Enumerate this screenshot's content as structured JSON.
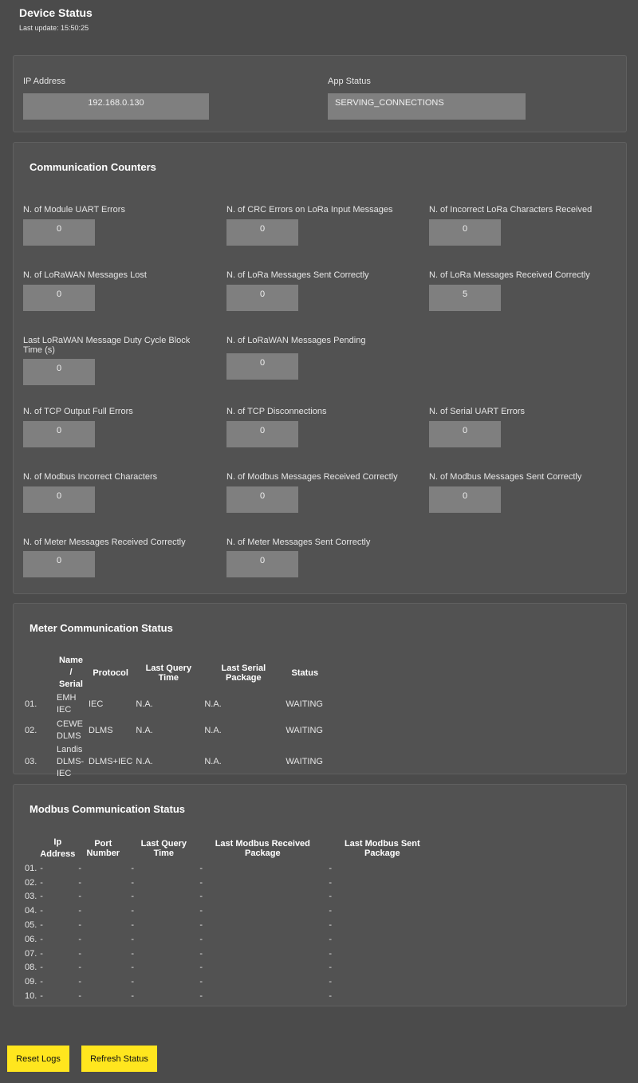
{
  "header": {
    "title": "Device Status",
    "last_update": "Last update: 15:50:25"
  },
  "network": {
    "ip_label": "IP Address",
    "ip_value": "192.168.0.130",
    "app_label": "App Status",
    "app_value": "SERVING_CONNECTIONS"
  },
  "counters": {
    "title": "Communication Counters",
    "items": [
      {
        "label": "N. of Module UART Errors",
        "value": "0"
      },
      {
        "label": "N. of CRC Errors on LoRa Input Messages",
        "value": "0"
      },
      {
        "label": "N. of Incorrect LoRa Characters Received",
        "value": "0"
      },
      {
        "label": "N. of LoRaWAN Messages Lost",
        "value": "0"
      },
      {
        "label": "N. of LoRa Messages Sent Correctly",
        "value": "0"
      },
      {
        "label": "N. of LoRa Messages Received Correctly",
        "value": "5"
      },
      {
        "label": "Last LoRaWAN Message Duty Cycle Block Time (s)",
        "value": "0"
      },
      {
        "label": "N. of LoRaWAN Messages Pending",
        "value": "0"
      },
      {
        "label": "N. of TCP Output Full Errors",
        "value": "0"
      },
      {
        "label": "N. of TCP Disconnections",
        "value": "0"
      },
      {
        "label": "N. of Serial UART Errors",
        "value": "0"
      },
      {
        "label": "N. of Modbus Incorrect Characters",
        "value": "0"
      },
      {
        "label": "N. of Modbus Messages Received Correctly",
        "value": "0"
      },
      {
        "label": "N. of Modbus Messages Sent Correctly",
        "value": "0"
      },
      {
        "label": "N. of Meter Messages Received Correctly",
        "value": "0"
      },
      {
        "label": "N. of Meter Messages Sent Correctly",
        "value": "0"
      }
    ]
  },
  "meter": {
    "title": "Meter Communication Status",
    "headers": [
      "",
      "Name / Serial",
      "Protocol",
      "Last Query Time",
      "Last Serial Package",
      "Status"
    ],
    "rows": [
      [
        "01.",
        "EMH IEC",
        "IEC",
        "N.A.",
        "N.A.",
        "WAITING"
      ],
      [
        "02.",
        "CEWE DLMS",
        "DLMS",
        "N.A.",
        "N.A.",
        "WAITING"
      ],
      [
        "03.",
        "Landis DLMS-IEC",
        "DLMS+IEC",
        "N.A.",
        "N.A.",
        "WAITING"
      ]
    ]
  },
  "modbus": {
    "title": "Modbus Communication Status",
    "headers": [
      "",
      "Ip Address",
      "Port Number",
      "Last Query Time",
      "Last Modbus Received Package",
      "Last Modbus Sent Package"
    ],
    "rows": [
      [
        "01.",
        "-",
        "-",
        "-",
        "-",
        "-"
      ],
      [
        "02.",
        "-",
        "-",
        "-",
        "-",
        "-"
      ],
      [
        "03.",
        "-",
        "-",
        "-",
        "-",
        "-"
      ],
      [
        "04.",
        "-",
        "-",
        "-",
        "-",
        "-"
      ],
      [
        "05.",
        "-",
        "-",
        "-",
        "-",
        "-"
      ],
      [
        "06.",
        "-",
        "-",
        "-",
        "-",
        "-"
      ],
      [
        "07.",
        "-",
        "-",
        "-",
        "-",
        "-"
      ],
      [
        "08.",
        "-",
        "-",
        "-",
        "-",
        "-"
      ],
      [
        "09.",
        "-",
        "-",
        "-",
        "-",
        "-"
      ],
      [
        "10.",
        "-",
        "-",
        "-",
        "-",
        "-"
      ]
    ]
  },
  "buttons": {
    "reset": "Reset Logs",
    "refresh": "Refresh Status"
  },
  "colors": {
    "background": "#4b4b4b",
    "panel": "#525252",
    "value_box": "#7f7f7f",
    "button": "#ffe61e"
  }
}
